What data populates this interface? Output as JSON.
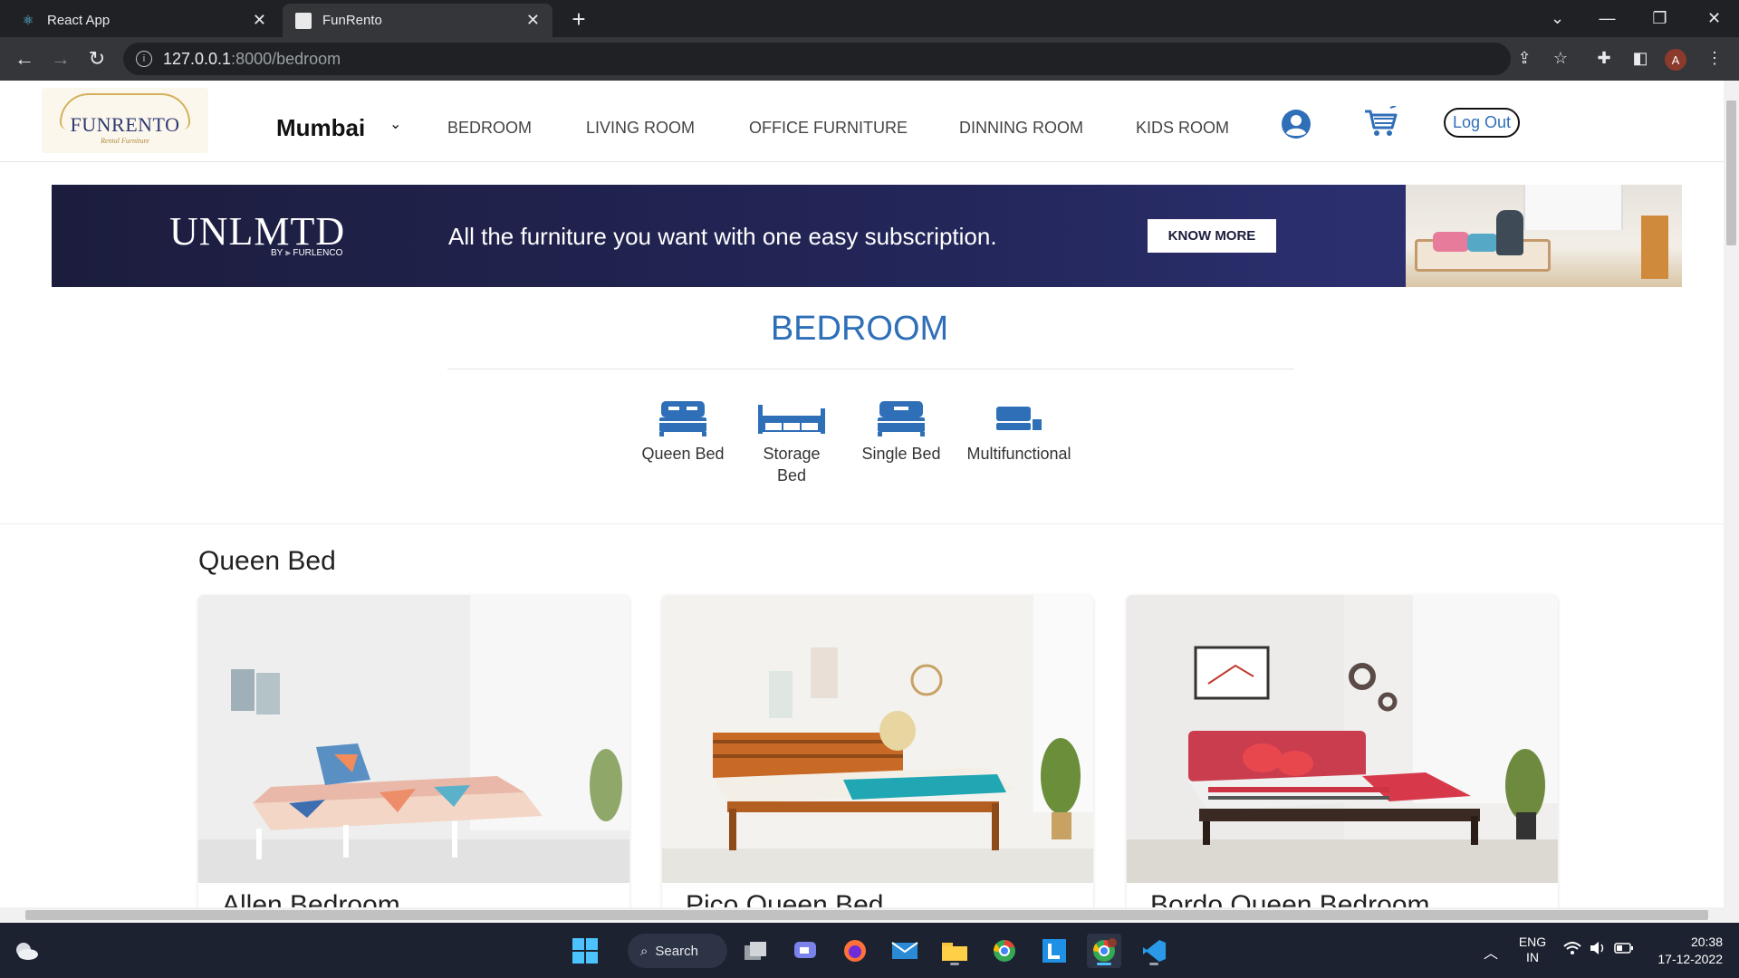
{
  "browser": {
    "tabs": [
      {
        "title": "React App"
      },
      {
        "title": "FunRento"
      }
    ],
    "address": {
      "host": "127.0.0.1",
      "path": ":8000/bedroom"
    },
    "profile_initial": "A"
  },
  "header": {
    "logo_text": "FUNRENTO",
    "logo_tagline": "Rental Furniture",
    "city": "Mumbai",
    "nav": [
      "BEDROOM",
      "LIVING ROOM",
      "OFFICE FURNITURE",
      "DINNING ROOM",
      "KIDS ROOM"
    ],
    "logout_label": "Log Out"
  },
  "banner": {
    "brand": "UNLMTD",
    "brand_sub": "BY ⫸ FURLENCO",
    "headline": "All the furniture you want with one easy subscription.",
    "cta": "KNOW MORE"
  },
  "page": {
    "title": "BEDROOM",
    "categories": [
      {
        "label_line1": "Queen Bed",
        "label_line2": ""
      },
      {
        "label_line1": "Storage",
        "label_line2": "Bed"
      },
      {
        "label_line1": "Single Bed",
        "label_line2": ""
      },
      {
        "label_line1": "Multifunctional",
        "label_line2": ""
      }
    ],
    "section": "Queen Bed",
    "products": [
      {
        "title": "Allen Bedroom"
      },
      {
        "title": "Pico Queen Bed"
      },
      {
        "title": "Bordo Queen Bedroom"
      }
    ]
  },
  "taskbar": {
    "search_label": "Search",
    "lang": "ENG",
    "region": "IN",
    "time": "20:38",
    "date": "17-12-2022"
  },
  "colors": {
    "accent": "#2f6fb8",
    "banner_bg": "#1c1d3d"
  }
}
